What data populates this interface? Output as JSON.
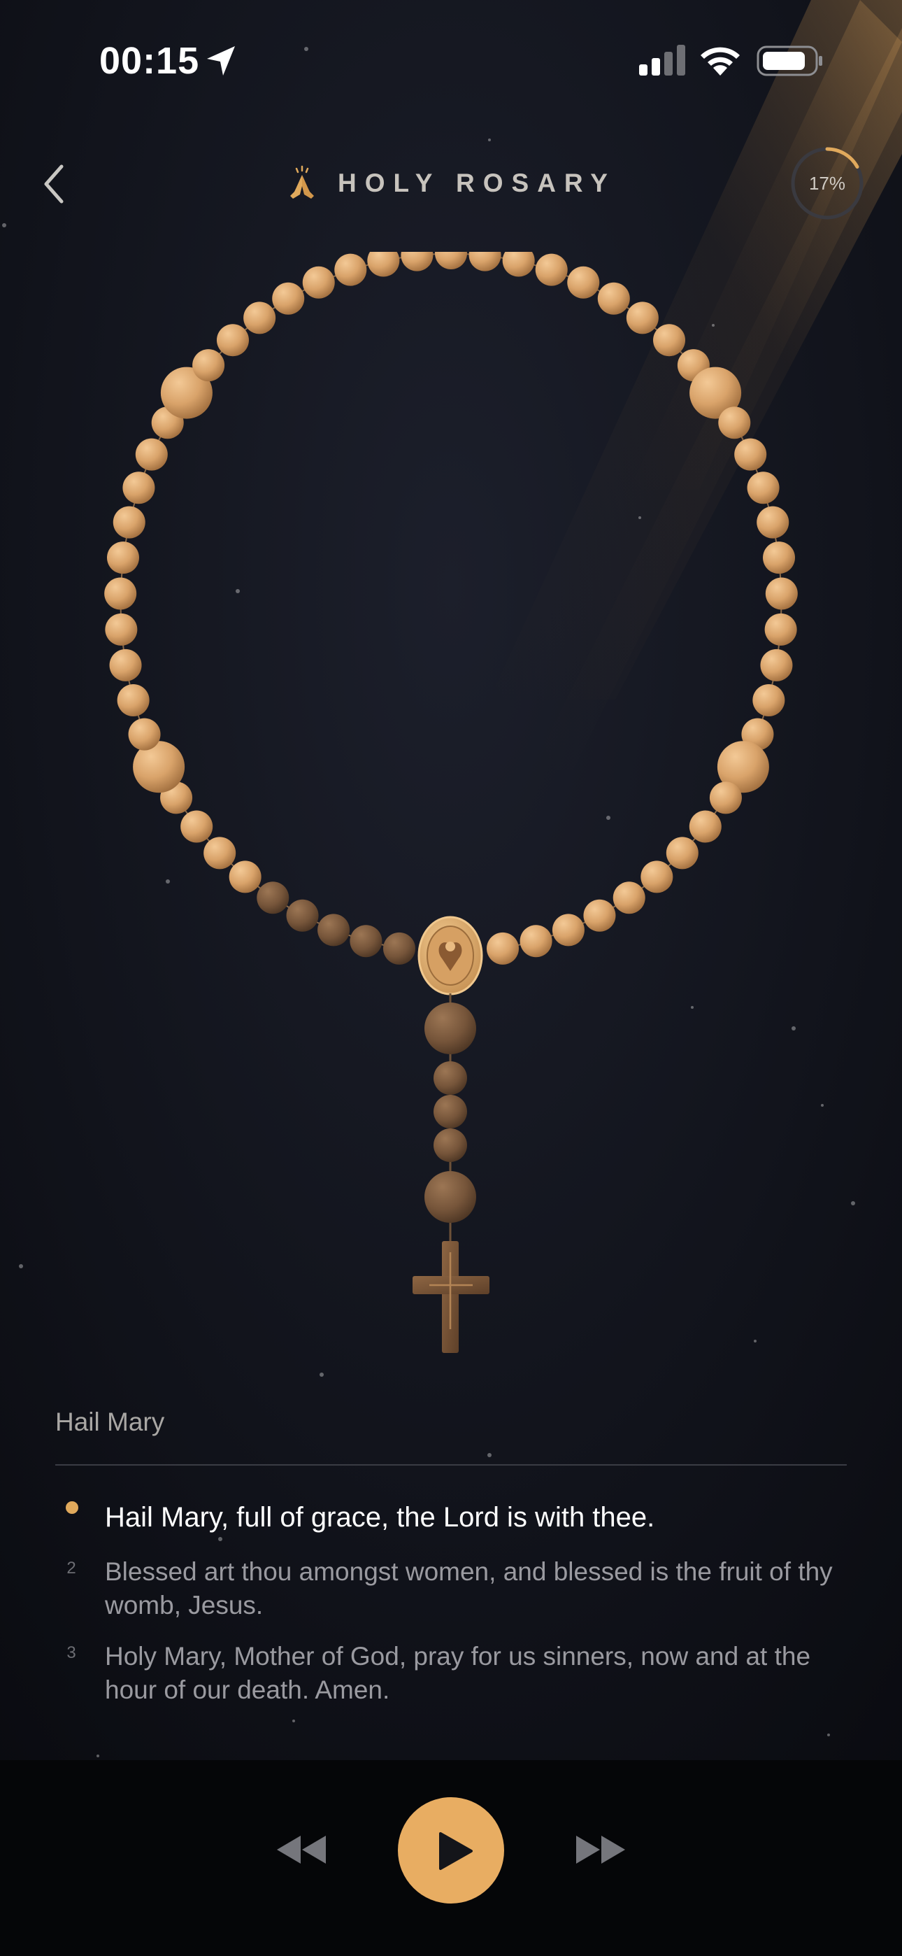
{
  "status_bar": {
    "time": "00:15"
  },
  "header": {
    "title": "HOLY ROSARY",
    "title_icon": "praying-hands-icon",
    "back_icon": "chevron-left-icon",
    "progress_label": "17%",
    "progress_value": 0.17
  },
  "prayer": {
    "name": "Hail Mary",
    "lines": [
      {
        "marker": "",
        "text": "Hail Mary, full of grace, the Lord is with thee."
      },
      {
        "marker": "2",
        "text": "Blessed art thou amongst women, and blessed is the fruit of thy womb, Jesus."
      },
      {
        "marker": "3",
        "text": "Holy Mary, Mother of God, pray for us sinners, now and at the hour of our death. Amen."
      }
    ]
  },
  "controls": {
    "rewind_icon": "rewind-icon",
    "play_icon": "play-icon",
    "forward_icon": "fast-forward-icon"
  },
  "colors": {
    "background": "#0d0f16",
    "accent": "#e8ad62",
    "bead": "#d8a26a",
    "bead_prayed": "#7a5a3e",
    "text_active": "#ffffff",
    "text_inactive": "#9a9aa0"
  }
}
